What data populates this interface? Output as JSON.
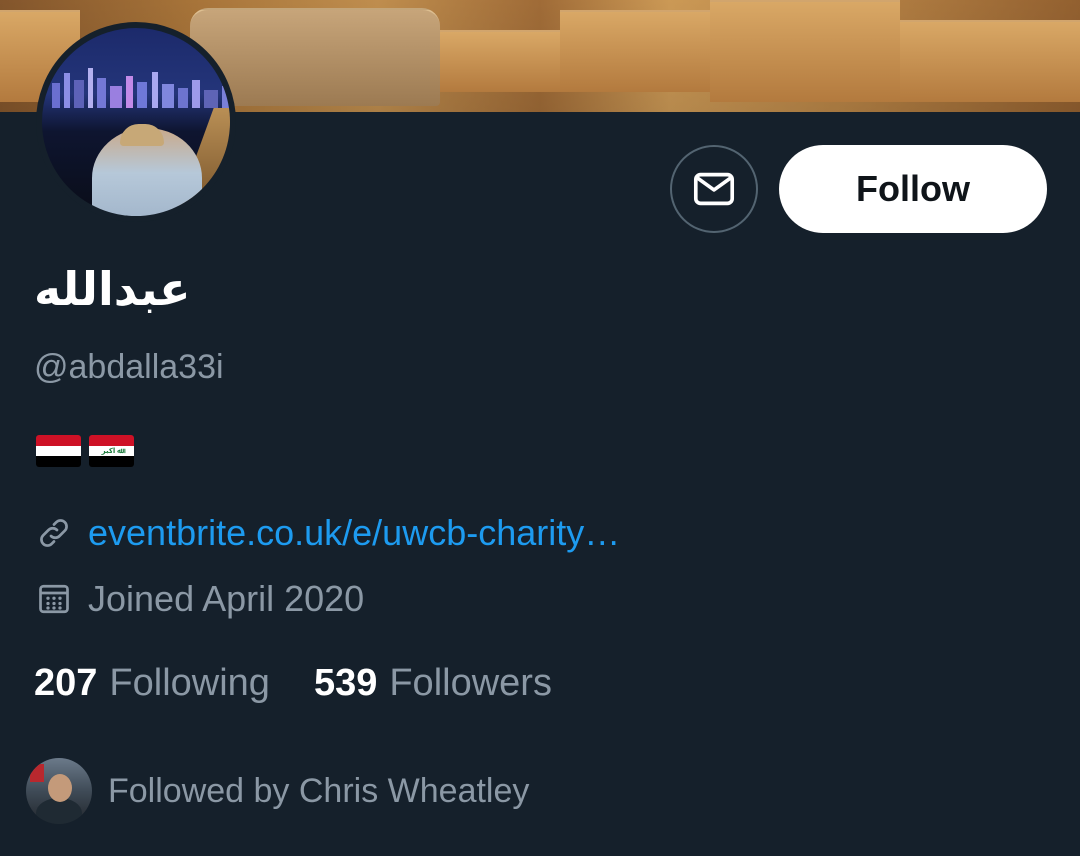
{
  "profile": {
    "display_name": "عبدالله",
    "handle": "@abdalla33i",
    "bio_flags": [
      "yemen-flag",
      "iraq-flag"
    ],
    "website": "eventbrite.co.uk/e/uwcb-charity…",
    "joined": "Joined April 2020",
    "following_count": "207",
    "following_label": "Following",
    "followers_count": "539",
    "followers_label": "Followers",
    "followed_by": "Followed by Chris Wheatley"
  },
  "actions": {
    "follow_label": "Follow",
    "message_icon": "mail-icon"
  },
  "icons": {
    "link": "link-icon",
    "calendar": "calendar-icon"
  },
  "colors": {
    "background": "#15202b",
    "link": "#1d9bf0",
    "secondary_text": "#8b98a5",
    "follow_button": "#ffffff"
  }
}
